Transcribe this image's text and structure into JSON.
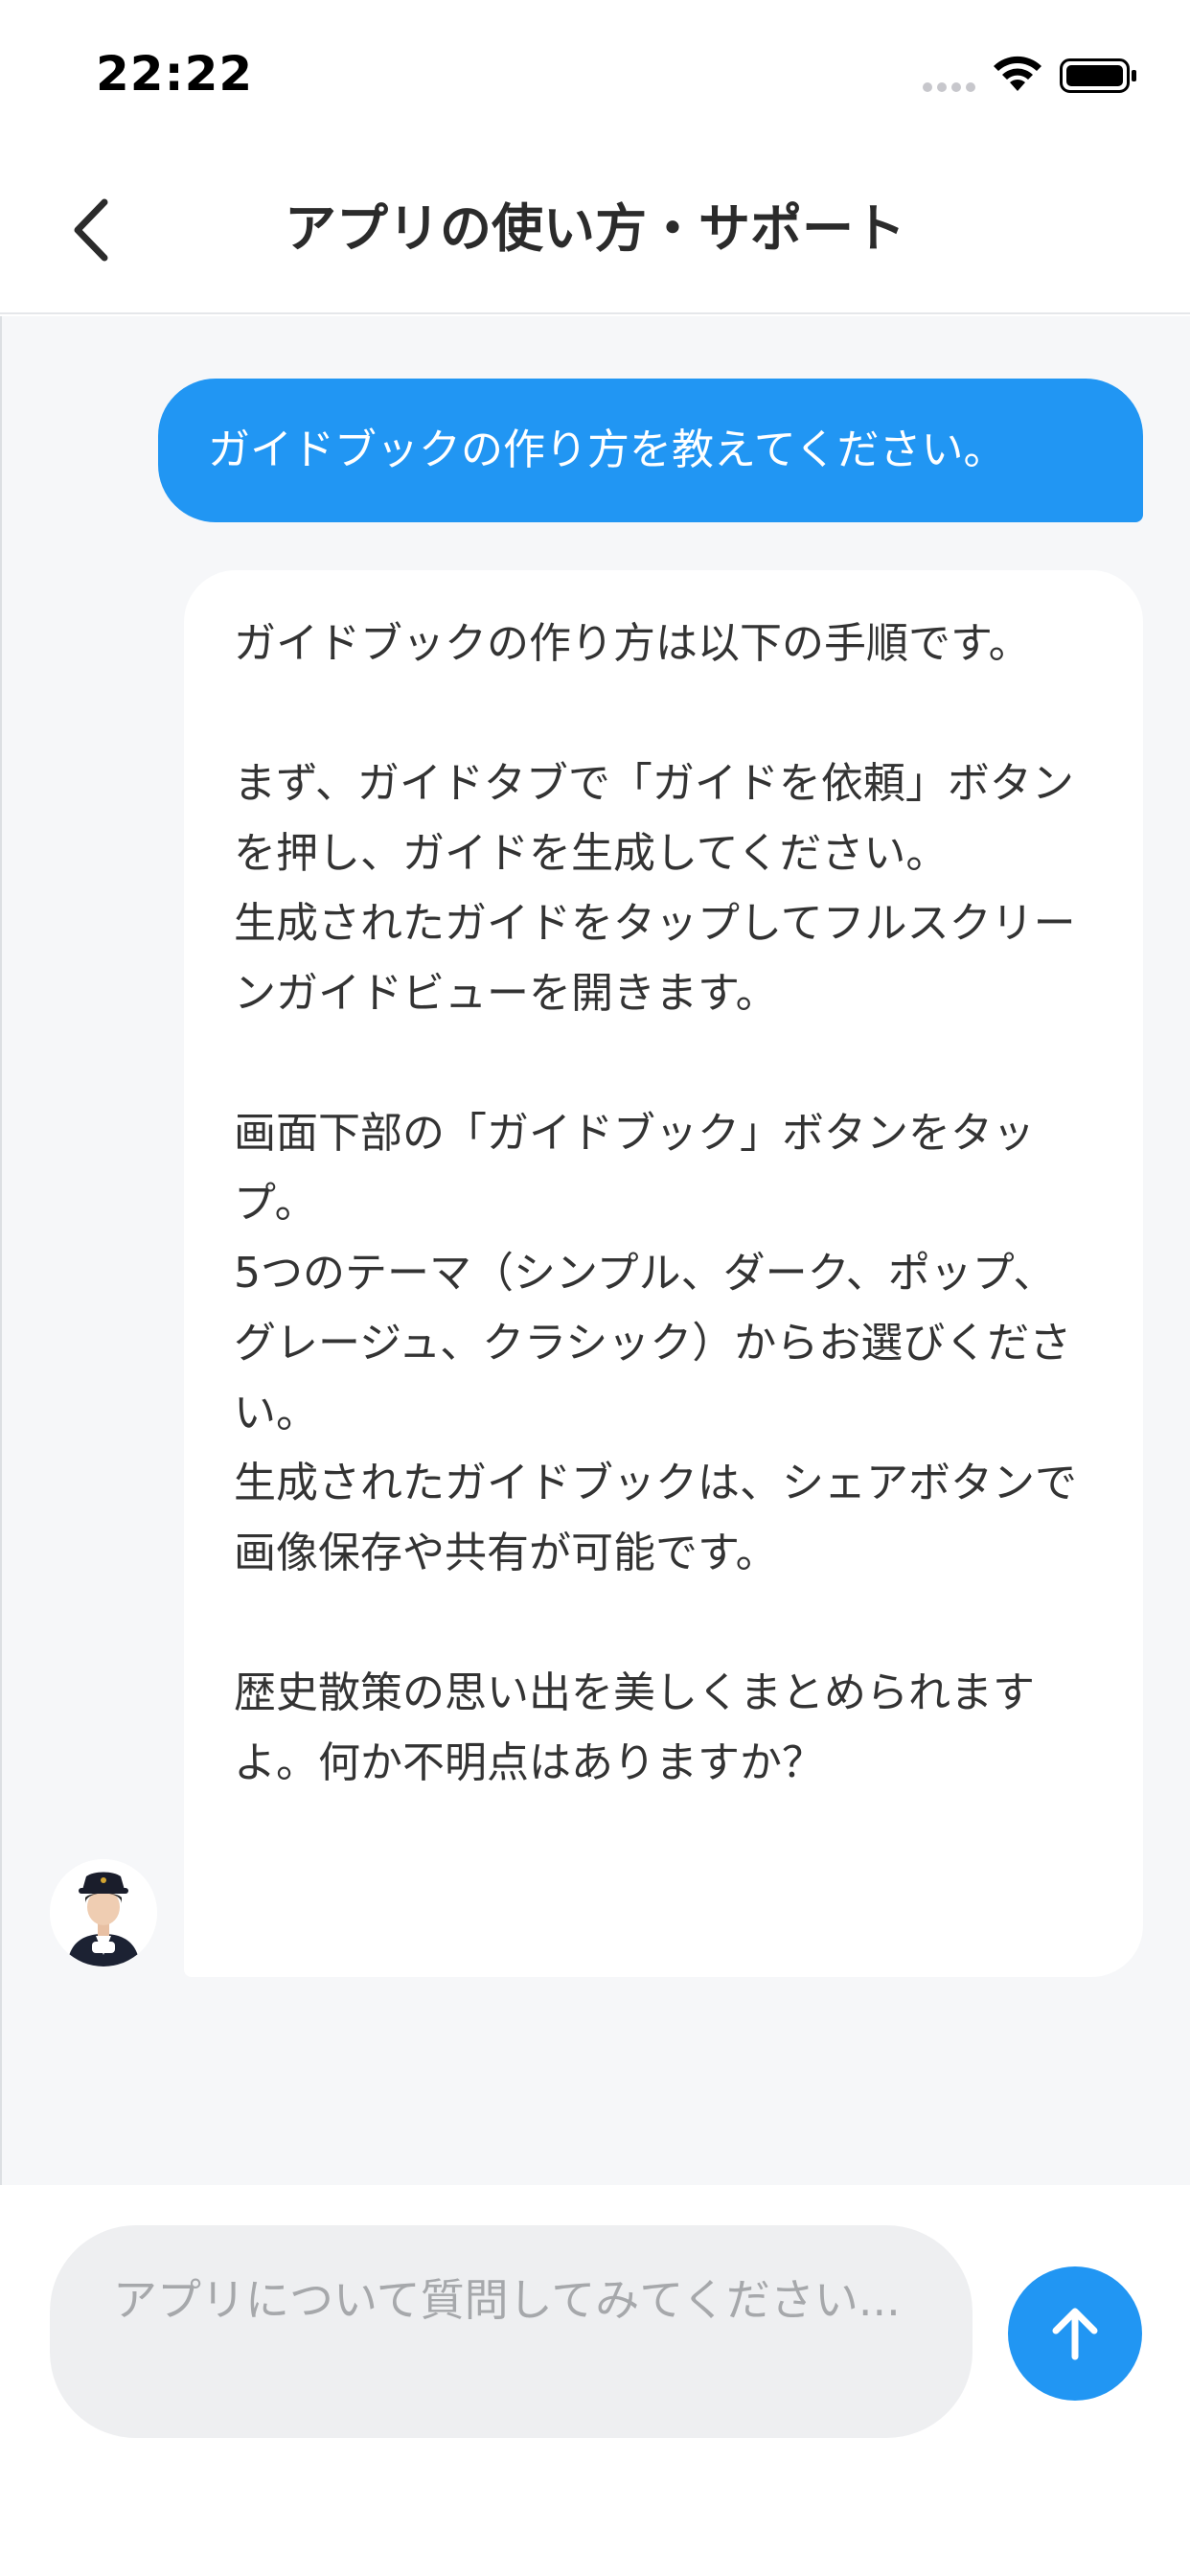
{
  "status_bar": {
    "time": "22:22"
  },
  "nav": {
    "title": "アプリの使い方・サポート",
    "back_icon": "chevron-left-icon"
  },
  "chat": {
    "messages": [
      {
        "role": "user",
        "text": "ガイドブックの作り方を教えてください。"
      },
      {
        "role": "assistant",
        "text": "ガイドブックの作り方は以下の手順です。\n\nまず、ガイドタブで「ガイドを依頼」ボタンを押し、ガイドを生成してください。\n生成されたガイドをタップしてフルスクリーンガイドビューを開きます。\n\n画面下部の「ガイドブック」ボタンをタップ。\n5つのテーマ（シンプル、ダーク、ポップ、グレージュ、クラシック）からお選びください。\n生成されたガイドブックは、シェアボタンで画像保存や共有が可能です。\n\n歴史散策の思い出を美しくまとめられますよ。何か不明点はありますか？"
      }
    ]
  },
  "composer": {
    "placeholder": "アプリについて質問してみてください...",
    "send_icon": "arrow-up-icon"
  },
  "colors": {
    "accent": "#2196f3",
    "chat_background": "#f6f7f9",
    "input_background": "#eeeff1"
  }
}
